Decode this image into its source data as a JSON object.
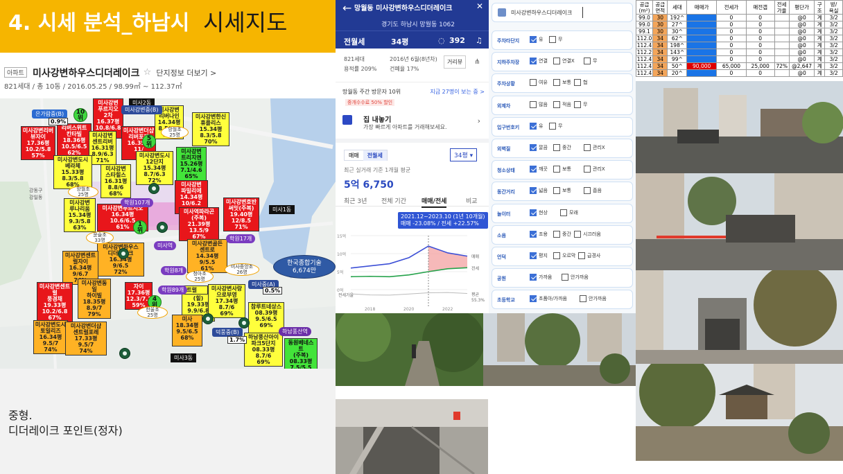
{
  "slide": {
    "title_main": "4. 시세 분석_하남시",
    "title_sub": "시세지도",
    "note_line1": "중형.",
    "note_line2": "디더레이크 포인트(정자)"
  },
  "apt_info": {
    "tag": "아파트",
    "name": "미사강변하우스디더레이크",
    "star": "☆",
    "link": "단지정보 더보기 >",
    "sub": "821세대 / 총 10동 / 2016.05.25 / 98.99㎡ ~ 112.37㎡"
  },
  "map": {
    "labels": [
      {
        "text": "미사강변\n푸르지오\n2차\n16.37평\n10.8/6.8\n63%",
        "c": "r"
      },
      {
        "text": "미사강변리버\n뷰자이\n17.36평\n10.2/5.8\n57%",
        "c": "r"
      },
      {
        "text": "리버스위트\n칸타빌\n18.36평\n10.5/6.5\n62%",
        "c": "r"
      },
      {
        "text": "미사강변더샵\n리버포레\n16.35평\n11/\n%",
        "c": "r"
      },
      {
        "text": "미사강변\n리버나인\n14.34평\n8.5/6.5\n76%",
        "c": "y"
      },
      {
        "text": "미사강변한신\n휴플리스\n15.34평\n8.3/5.8\n70%",
        "c": "y"
      },
      {
        "text": "미사강변\n센트리버\n16.31평\n8.9/6.3\n71%",
        "c": "y"
      },
      {
        "text": "미사강변도시\n12단지\n15.34평\n8.7/6.3\n72%",
        "c": "y"
      },
      {
        "text": "미사강변\n트리지엔\n15.26평\n7.1/4.6\n65%",
        "c": "g"
      },
      {
        "text": "미사강변도시\n베라체\n15.33평\n8.3/5.8\n68%",
        "c": "y"
      },
      {
        "text": "미사강변\n스타힐스\n16.31평\n8.8/6\n68%",
        "c": "y"
      },
      {
        "text": "미사강변\n파밀리에\n14.34평\n10/6.2\n62%",
        "c": "r"
      },
      {
        "text": "미사강변\n루나리움\n15.34평\n9.3/5.8\n63%",
        "c": "y"
      },
      {
        "text": "미사강변푸르지오\n16.34평\n10.6/6.5\n61%",
        "c": "r"
      },
      {
        "text": "미사역파라곤\n(주복)\n21.39평\n13.5/9\n67%",
        "c": "r"
      },
      {
        "text": "미사강변호반\n써밋(주복)\n19.40평\n12/8.5\n71%",
        "c": "r"
      },
      {
        "text": "미사강변하우스\n디더레이크\n16.34평\n9/6.5\n72%",
        "c": "o"
      },
      {
        "text": "미사강변골든\n센트로\n14.34평\n9/5.5\n61%",
        "c": "o"
      },
      {
        "text": "미사강변센트\n럴자이\n16.34평\n9/6.7\n74%",
        "c": "o"
      },
      {
        "text": "미사강변센트럴\n풍경채\n19.33평\n10.2/6.8\n67%",
        "c": "r"
      },
      {
        "text": "미사강변동일\n하이빌\n18.35평\n8.9/7\n79%",
        "c": "o"
      },
      {
        "text": "자이\n17.36평\n12.3/7.3\n59%",
        "c": "r"
      },
      {
        "text": "센트럴",
        "c": "y"
      },
      {
        "text": "(힐)\n19.33평\n9.9/6.8\n69%",
        "c": "y"
      },
      {
        "text": "미사강변사랑\n으로부영\n17.34평\n8.7/6\n69%",
        "c": "y"
      },
      {
        "text": "참루트네상스\n08.39평\n9.5/6.5\n69%",
        "c": "y"
      },
      {
        "text": "미사강변도시\n토일리즈\n16.34평\n9.5/7\n74%",
        "c": "o"
      },
      {
        "text": "미사강변더샵\n센트럴포레\n17.33평\n9.5/7\n74%",
        "c": "o"
      },
      {
        "text": "미사\n18.34평\n9.5/6.5\n68%",
        "c": "o"
      },
      {
        "text": "하남풍산아이\n파크5단지\n08.33평\n8.7/6\n69%",
        "c": "y"
      },
      {
        "text": "동원베네스트\n(주복)\n08.33평\n7.5/5.5\n%",
        "c": "g"
      }
    ],
    "pills": [
      {
        "text": "은가람중(B)",
        "c": "blue"
      },
      {
        "text": "미사2동",
        "c": "black"
      },
      {
        "text": "미사강변중(B)",
        "c": "navy"
      },
      {
        "text": "미사역",
        "c": "purple"
      },
      {
        "text": "학원107개",
        "c": "purple"
      },
      {
        "text": "학원17개",
        "c": "purple"
      },
      {
        "text": "학원8개",
        "c": "purple"
      },
      {
        "text": "학원89개",
        "c": "purple"
      },
      {
        "text": "미사1동",
        "c": "black"
      },
      {
        "text": "미사중(A)",
        "c": "navy"
      },
      {
        "text": "덕풍중(B)",
        "c": "navy"
      },
      {
        "text": "하남풍산역",
        "c": "darkpurple"
      },
      {
        "text": "미사3동",
        "c": "black"
      }
    ],
    "pcts": [
      "0.9%",
      "0.5%",
      "1.7%"
    ],
    "ranks": [
      "10\n위",
      "5\n위",
      "1\n위",
      "4\n위"
    ],
    "ovals": [
      "망월초\n25명",
      "윤슬초\n33명",
      "미사중앙초\n26명",
      "청아초\n25명",
      "망월초\n25명",
      "한울초\n25명"
    ],
    "station": "한국종합기술\n6,674만",
    "small": [
      "강동구\n강일동",
      "미사중\n26명",
      "미사초\n25명"
    ]
  },
  "mobile": {
    "title": "망월동 미사강변하우스디더레이크",
    "address": "경기도 하남시 망월동 1062",
    "type_tab": "전월세",
    "area_tab": "34평",
    "comment_count": "392",
    "households": "821세대",
    "built": "2016년 6월(8년차)",
    "ratio_left": "용적률 209%",
    "ratio_right": "건폐율 17%",
    "nearby_btn": "거리뷰",
    "visit": "망월동 주간 방문자 10위",
    "visit_more": "지금 27명이 보는 중 >",
    "promo": "중개수수료 50% 할인",
    "sell_title": "집 내놓기",
    "sell_desc": "가장 빠르게 아파트를 거래해보세요.",
    "seg": [
      "매매",
      "전월세"
    ],
    "area_select": "34평 ▾",
    "price_caption": "최근 실거래 기준 1개월 평균",
    "price": "5억 6,750",
    "chart_tabs": [
      "최근 3년",
      "전체 기간",
      "매매/전세",
      "비교"
    ],
    "tooltip_line1": "2021.12~2023.10 (1년 10개월)",
    "tooltip_line2": "매매 -23.08% / 전세 +22.57%",
    "years": [
      "2018",
      "2020",
      "2022"
    ],
    "yticks": [
      "15억",
      "10억",
      "5억",
      "0억"
    ],
    "side_labels": [
      "매매",
      "전세",
      "평균",
      "55.3%"
    ],
    "bottom_label": "전세가율"
  },
  "filters": {
    "search": "미사강변하우스디더레이크",
    "rows": [
      {
        "label": "주차타단지",
        "opts": [
          [
            "유",
            true
          ],
          [
            "무",
            false
          ]
        ]
      },
      {
        "label": "지하주차장",
        "opts": [
          [
            "연결",
            true
          ],
          [
            "연결X",
            false
          ],
          [
            "무",
            false
          ]
        ]
      },
      {
        "label": "주차상황",
        "opts": [
          [
            "여유",
            false
          ],
          [
            "보통",
            false
          ],
          [
            "협",
            false
          ]
        ]
      },
      {
        "label": "외제차",
        "opts": [
          [
            "많음",
            false
          ],
          [
            "적음",
            false
          ],
          [
            "무",
            false
          ]
        ]
      },
      {
        "label": "입구번호키",
        "opts": [
          [
            "유",
            true
          ],
          [
            "무",
            false
          ]
        ]
      },
      {
        "label": "외벽질",
        "opts": [
          [
            "깔끔",
            true
          ],
          [
            "중간",
            false
          ],
          [
            "관리X",
            false
          ]
        ]
      },
      {
        "label": "청소상태",
        "opts": [
          [
            "깨끗",
            true
          ],
          [
            "보통",
            false
          ],
          [
            "관리X",
            false
          ]
        ]
      },
      {
        "label": "동간거리",
        "opts": [
          [
            "넓음",
            true
          ],
          [
            "보통",
            false
          ],
          [
            "좁음",
            false
          ]
        ]
      },
      {
        "label": "놀이터",
        "opts": [
          [
            "현상",
            true
          ],
          [
            "모래",
            false
          ]
        ]
      },
      {
        "label": "소음",
        "opts": [
          [
            "조용",
            true
          ],
          [
            "중간",
            false
          ],
          [
            "시끄러움",
            false
          ]
        ]
      },
      {
        "label": "언덕",
        "opts": [
          [
            "평지",
            true
          ],
          [
            "오르막",
            false
          ],
          [
            "급경사",
            false
          ]
        ]
      },
      {
        "label": "공원",
        "opts": [
          [
            "가까움",
            true
          ],
          [
            "안가까움",
            false
          ]
        ]
      },
      {
        "label": "초등학교",
        "opts": [
          [
            "초품아/가까움",
            true
          ],
          [
            "안가까움",
            false
          ]
        ]
      }
    ]
  },
  "table": {
    "headers": [
      "공급\n(m²)",
      "공급\n면적",
      "세대",
      "매매가",
      "전세가",
      "매전갭",
      "전세\n가율",
      "평단가",
      "구\n조",
      "방/\n욕실"
    ],
    "rows": [
      [
        "99.0",
        "30",
        "192^",
        "",
        "0",
        "0",
        "",
        "@0",
        "계",
        "3/2"
      ],
      [
        "99.0",
        "30",
        "27^",
        "",
        "0",
        "0",
        "",
        "@0",
        "계",
        "3/2"
      ],
      [
        "99.1",
        "30",
        "30^",
        "",
        "0",
        "0",
        "",
        "@0",
        "계",
        "3/2"
      ],
      [
        "112.0",
        "34",
        "62^",
        "",
        "0",
        "0",
        "",
        "@0",
        "계",
        "3/2"
      ],
      [
        "112.4",
        "34",
        "198^",
        "",
        "0",
        "0",
        "",
        "@0",
        "계",
        "3/2"
      ],
      [
        "112.2",
        "34",
        "143^",
        "",
        "0",
        "0",
        "",
        "@0",
        "계",
        "3/2"
      ],
      [
        "112.4",
        "34",
        "99^",
        "",
        "0",
        "0",
        "",
        "@0",
        "계",
        "3/2"
      ],
      [
        "112.4",
        "34",
        "50^",
        "90,000",
        "65,000",
        "25,000",
        "72%",
        "@2,647",
        "계",
        "3/2"
      ],
      [
        "112.4",
        "34",
        "20^",
        "",
        "0",
        "0",
        "",
        "@0",
        "계",
        "3/2"
      ]
    ]
  },
  "chart_data": {
    "type": "line",
    "x": [
      "2017",
      "2018",
      "2019",
      "2020",
      "2021",
      "2022",
      "2023"
    ],
    "series": [
      {
        "name": "매매",
        "values": [
          6.0,
          6.6,
          7.2,
          8.9,
          12.1,
          10.2,
          9.3
        ]
      },
      {
        "name": "전세",
        "values": [
          3.6,
          3.7,
          3.6,
          4.1,
          5.0,
          5.8,
          6.1
        ]
      }
    ],
    "ylabel": "",
    "ylim": [
      0,
      15
    ],
    "colors": {
      "sale": "#3c4fd6",
      "rent": "#24a24a",
      "band": "#f4a7a7"
    }
  }
}
